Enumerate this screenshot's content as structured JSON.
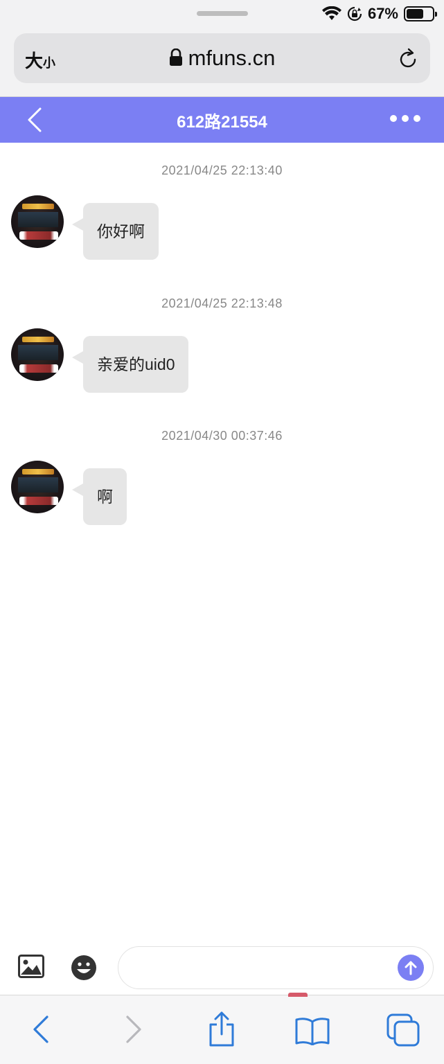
{
  "status_bar": {
    "battery_percent": "67%",
    "battery_level": 0.67
  },
  "address_bar": {
    "text_size_label_big": "大",
    "text_size_label_small": "小",
    "url": "mfuns.cn"
  },
  "header": {
    "title": "612路21554"
  },
  "messages": [
    {
      "timestamp": "2021/04/25 22:13:40",
      "text": "你好啊"
    },
    {
      "timestamp": "2021/04/25 22:13:48",
      "text": "亲爱的uid0"
    },
    {
      "timestamp": "2021/04/30 00:37:46",
      "text": "啊"
    }
  ],
  "composer": {
    "placeholder": "",
    "value": ""
  },
  "colors": {
    "accent": "#7b7ff3",
    "bubble": "#e6e6e6",
    "safari_blue": "#2f7bd8"
  },
  "icons": {
    "header": [
      "back-icon",
      "more-icon"
    ],
    "composer": [
      "image-icon",
      "emoji-icon",
      "send-arrow-icon"
    ],
    "toolbar": [
      "back-arrow-icon",
      "forward-arrow-icon",
      "share-icon",
      "bookmarks-icon",
      "tabs-icon"
    ]
  }
}
